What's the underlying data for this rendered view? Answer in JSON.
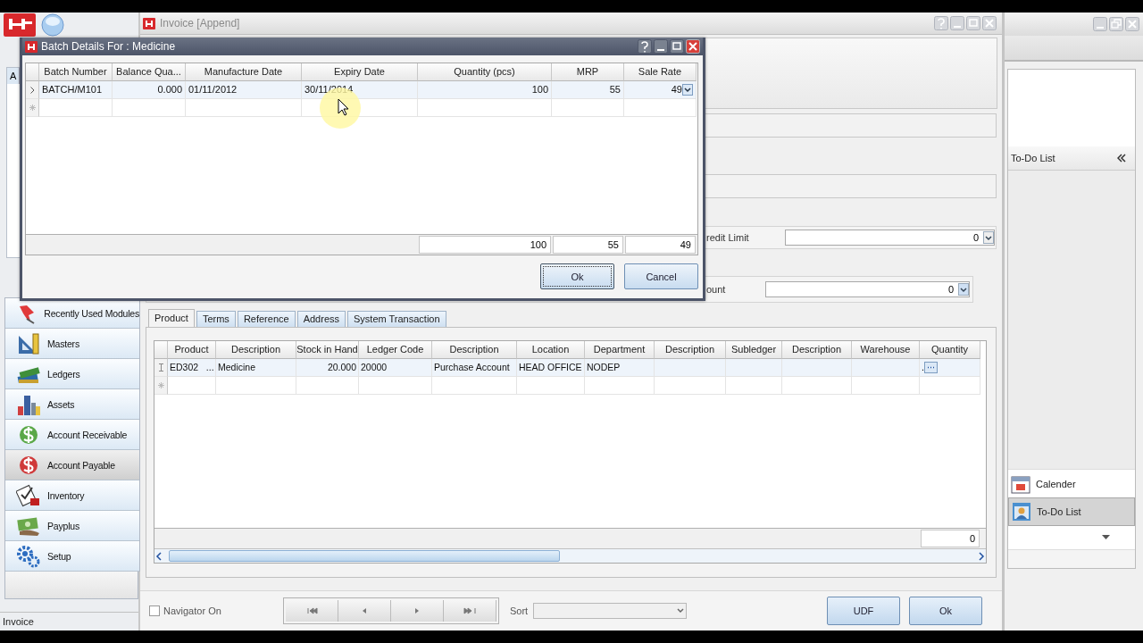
{
  "left_panel": {
    "tab": "A"
  },
  "sidebar": {
    "items": [
      {
        "label": "Recently Used Modules",
        "selected": false
      },
      {
        "label": "Masters",
        "selected": false
      },
      {
        "label": "Ledgers",
        "selected": false
      },
      {
        "label": "Assets",
        "selected": false
      },
      {
        "label": "Account Receivable",
        "selected": false
      },
      {
        "label": "Account Payable",
        "selected": true
      },
      {
        "label": "Inventory",
        "selected": false
      },
      {
        "label": "Payplus",
        "selected": false
      },
      {
        "label": "Setup",
        "selected": false
      }
    ]
  },
  "status_bar": "Invoice",
  "window": {
    "title": "Invoice [Append]"
  },
  "fields": [
    {
      "label": "redit Limit",
      "value": "0"
    },
    {
      "label": "ount",
      "value": "0"
    }
  ],
  "tabs": [
    {
      "label": "Product",
      "selected": true
    },
    {
      "label": "Terms",
      "selected": false
    },
    {
      "label": "Reference",
      "selected": false
    },
    {
      "label": "Address",
      "selected": false
    },
    {
      "label": "System Transaction",
      "selected": false
    }
  ],
  "product_grid": {
    "columns": [
      "Product",
      "Description",
      "Stock in Hand",
      "Ledger Code",
      "Description",
      "Location",
      "Department",
      "Description",
      "Subledger",
      "Description",
      "Warehouse",
      "Quantity"
    ],
    "rows": [
      {
        "kind": "ellipsis",
        "selected": true,
        "cells": [
          "ED302   ...",
          "Medicine",
          "20.000",
          "20000",
          "Purchase Account",
          "HEAD OFFICE",
          "NODEP",
          "",
          "",
          "",
          "",
          "."
        ]
      },
      {
        "kind": "new",
        "selected": false
      }
    ],
    "totals": [
      "0"
    ]
  },
  "navigator": {
    "label": "Navigator On",
    "checked": false
  },
  "sort": {
    "label": "Sort"
  },
  "buttons": [
    "UDF",
    "Ok"
  ],
  "right_panel": {
    "title": "To-Do List",
    "items": [
      {
        "label": "Calender",
        "selected": false
      },
      {
        "label": "To-Do List",
        "selected": true
      }
    ]
  },
  "dialog": {
    "title": "Batch Details For : Medicine",
    "grid": {
      "columns": [
        "Batch Number",
        "Balance Qua...",
        "Manufacture Date",
        "Expiry Date",
        "Quantity (pcs)",
        "MRP",
        "Sale Rate"
      ],
      "rows": [
        {
          "kind": "dropdown",
          "selected": true,
          "cells": [
            "BATCH/M101",
            "0.000",
            "01/11/2012",
            "30/11/2014",
            "100",
            "55",
            "49"
          ]
        },
        {
          "kind": "new",
          "selected": false
        }
      ],
      "totals": [
        "100",
        "55",
        "49"
      ]
    },
    "buttons": [
      "Ok",
      "Cancel"
    ]
  }
}
